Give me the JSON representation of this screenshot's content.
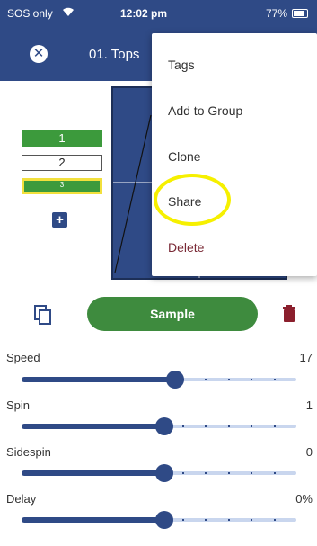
{
  "status_bar": {
    "carrier": "SOS only",
    "time": "12:02 pm",
    "battery": "77%"
  },
  "header": {
    "drill_title": "01. Tops"
  },
  "balls": [
    {
      "label": "1"
    },
    {
      "label": "2"
    },
    {
      "label": "3"
    }
  ],
  "actions": {
    "sample_label": "Sample"
  },
  "sliders": [
    {
      "label": "Speed",
      "value": "17",
      "level": 0.56
    },
    {
      "label": "Spin",
      "value": "1",
      "level": 0.52
    },
    {
      "label": "Sidespin",
      "value": "0",
      "level": 0.52
    },
    {
      "label": "Delay",
      "value": "0%",
      "level": 0.52
    }
  ],
  "menu": {
    "items": [
      "Tags",
      "Add to Group",
      "Clone",
      "Share",
      "Delete"
    ]
  },
  "colors": {
    "primary": "#2f4a86",
    "green": "#3e8b3e",
    "highlight": "#f6f000",
    "delete": "#7a2a36"
  }
}
